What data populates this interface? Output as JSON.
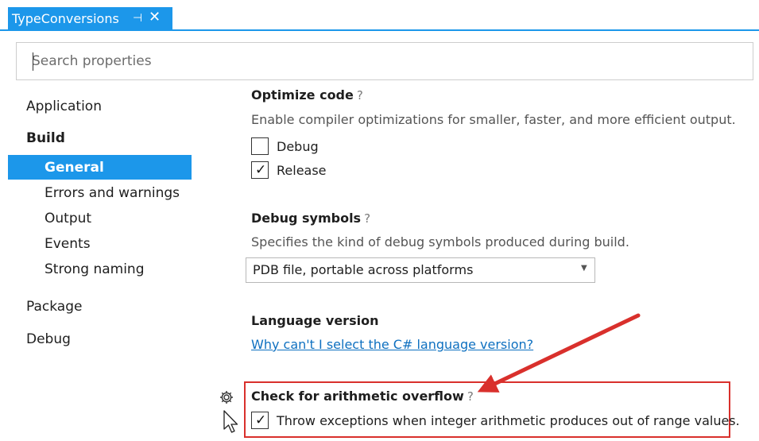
{
  "tab": {
    "title": "TypeConversions",
    "pin_glyph": "⊣",
    "close_glyph": "✕"
  },
  "search": {
    "placeholder": "Search properties",
    "value": ""
  },
  "sidebar": {
    "application": "Application",
    "build": "Build",
    "build_items": [
      "General",
      "Errors and warnings",
      "Output",
      "Events",
      "Strong naming"
    ],
    "package": "Package",
    "debug": "Debug"
  },
  "settings": {
    "optimize": {
      "title": "Optimize code",
      "help": "?",
      "description": "Enable compiler optimizations for smaller, faster, and more efficient output.",
      "options": [
        {
          "label": "Debug",
          "checked": false
        },
        {
          "label": "Release",
          "checked": true
        }
      ]
    },
    "debug_symbols": {
      "title": "Debug symbols",
      "help": "?",
      "description": "Specifies the kind of debug symbols produced during build.",
      "selected": "PDB file, portable across platforms"
    },
    "language_version": {
      "title": "Language version",
      "link": "Why can't I select the C# language version?"
    },
    "overflow": {
      "title": "Check for arithmetic overflow",
      "help": "?",
      "option_label": "Throw exceptions when integer arithmetic produces out of range values.",
      "checked": true
    }
  },
  "colors": {
    "accent": "#1c97ea",
    "highlight": "#d9302c",
    "link": "#0e70c0"
  },
  "icons": [
    "pin-icon",
    "close-icon",
    "gear-icon",
    "mouse-cursor-icon",
    "annotation-arrow"
  ]
}
